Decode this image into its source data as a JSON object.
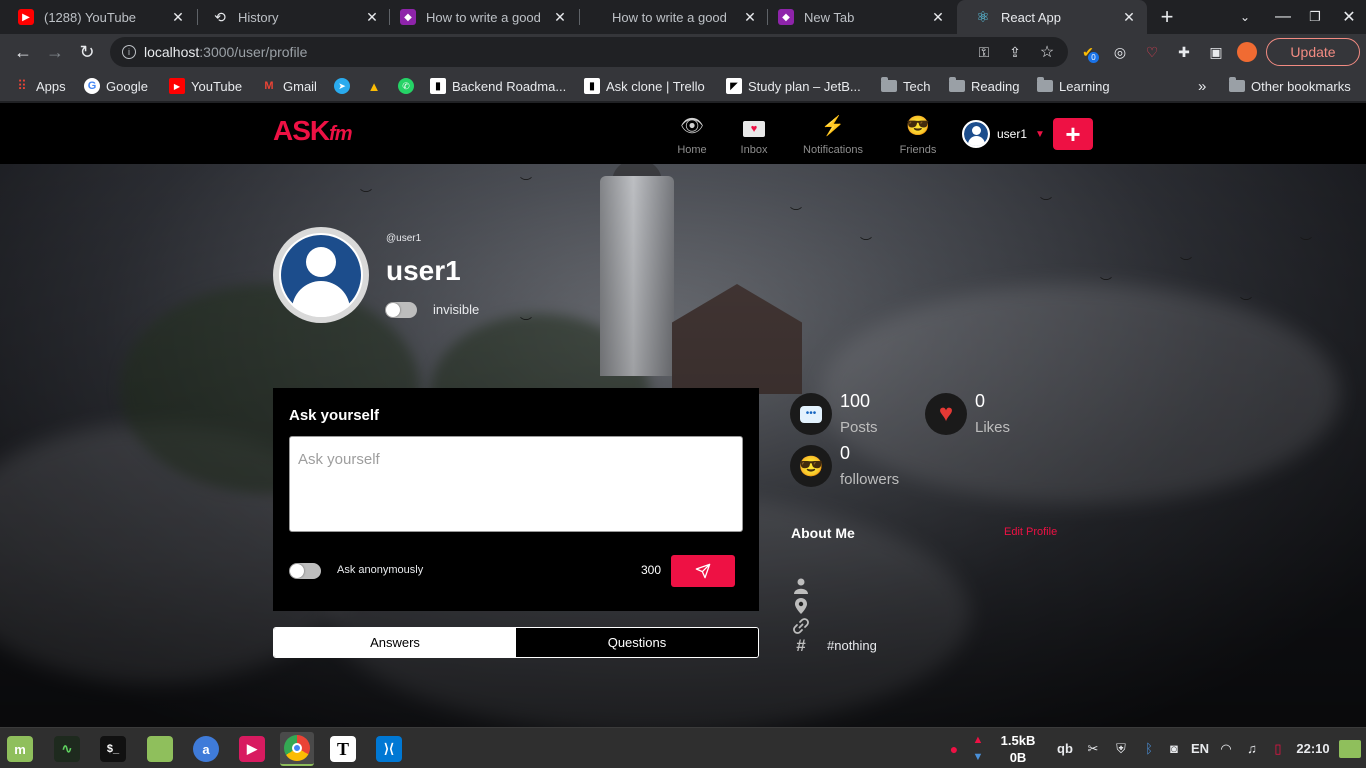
{
  "browser": {
    "tabs": [
      {
        "title": "(1288) YouTube",
        "favicon": "youtube-icon",
        "color": "#ff0000"
      },
      {
        "title": "History",
        "favicon": "history-icon",
        "color": "#5f6368"
      },
      {
        "title": "How to write a good",
        "favicon": "app-icon",
        "color": "#8e24aa"
      },
      {
        "title": "How to write a good",
        "favicon": "app-icon",
        "color": "#8e24aa"
      },
      {
        "title": "New Tab",
        "favicon": "app-icon",
        "color": "#8e24aa"
      },
      {
        "title": "React App",
        "favicon": "react-icon",
        "color": "#61dafb"
      }
    ],
    "url_host": "localhost",
    "url_path": ":3000/user/profile",
    "update_label": "Update",
    "extension_badge": "0",
    "bookmarks": [
      {
        "label": "Apps"
      },
      {
        "label": "Google"
      },
      {
        "label": "YouTube"
      },
      {
        "label": "Gmail"
      },
      {
        "label": "Backend Roadma..."
      },
      {
        "label": "Ask clone | Trello"
      },
      {
        "label": "Study plan – JetB..."
      },
      {
        "label": "Tech"
      },
      {
        "label": "Reading"
      },
      {
        "label": "Learning"
      }
    ],
    "other_bookmarks": "Other bookmarks"
  },
  "app": {
    "logo_main": "ASK",
    "logo_sub": "fm",
    "accent": "#ee1144",
    "nav": [
      {
        "label": "Home",
        "icon": "eye-icon"
      },
      {
        "label": "Inbox",
        "icon": "inbox-icon"
      },
      {
        "label": "Notifications",
        "icon": "lightning-icon"
      },
      {
        "label": "Friends",
        "icon": "friends-icon"
      }
    ],
    "user": "user1",
    "add_icon": "plus-icon"
  },
  "profile": {
    "handle": "@user1",
    "name": "user1",
    "invisible_label": "invisible",
    "invisible_on": false
  },
  "ask": {
    "title": "Ask yourself",
    "placeholder": "Ask yourself",
    "anonymous_label": "Ask anonymously",
    "anonymous_on": false,
    "char_count": "300"
  },
  "tabs": {
    "answers": "Answers",
    "questions": "Questions",
    "active": "Answers"
  },
  "stats": {
    "posts": {
      "value": "100",
      "label": "Posts"
    },
    "likes": {
      "value": "0",
      "label": "Likes"
    },
    "followers": {
      "value": "0",
      "label": "followers"
    }
  },
  "about": {
    "title": "About Me",
    "edit_label": "Edit Profile",
    "interests": "#nothing"
  },
  "system": {
    "net_up": "1.5kB",
    "net_down": "0B",
    "lang": "EN",
    "clock": "22:10"
  }
}
